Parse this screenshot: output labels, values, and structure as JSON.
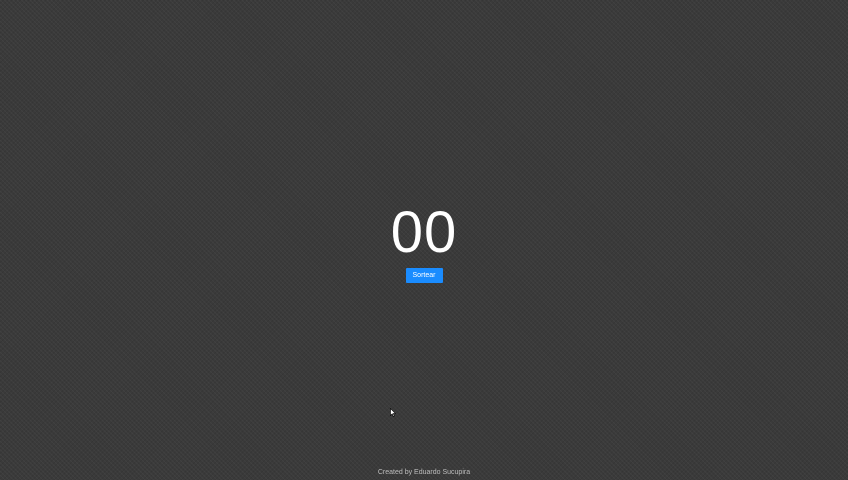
{
  "main": {
    "number": "00",
    "draw_button_label": "Sortear"
  },
  "footer": {
    "credit": "Created by Eduardo Sucupira"
  },
  "colors": {
    "background": "#3a3a3a",
    "button": "#1a8cff",
    "text": "#ffffff"
  },
  "icons": {
    "cursor": "mouse-pointer-icon"
  }
}
